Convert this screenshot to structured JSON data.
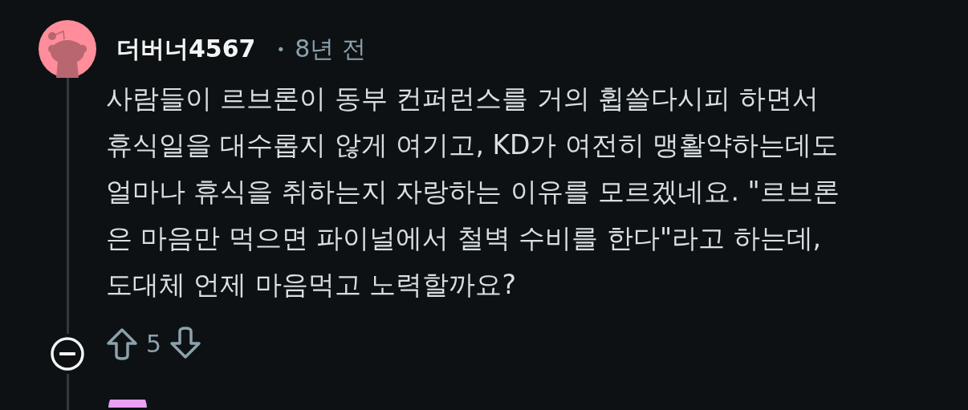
{
  "comment": {
    "author": "더버너4567",
    "separator": "•",
    "time": "8년 전",
    "avatar": {
      "color": "#ff8d9b"
    },
    "body": "사람들이 르브론이 동부 컨퍼런스를 거의 휩쓸다시피 하면서\n휴식일을 대수롭지 않게 여기고, KD가 여전히 맹활약하는데도\n얼마나 휴식을 취하는지 자랑하는 이유를 모르겠네요. \"르브론\n은 마음만 먹으면 파이널에서 철벽 수비를 한다\"라고 하는데,\n도대체 언제 마음먹고 노력할까요?",
    "score": "5",
    "expanded": true
  },
  "next_comment": {
    "avatar": {
      "color": "#e9a0f5"
    }
  }
}
